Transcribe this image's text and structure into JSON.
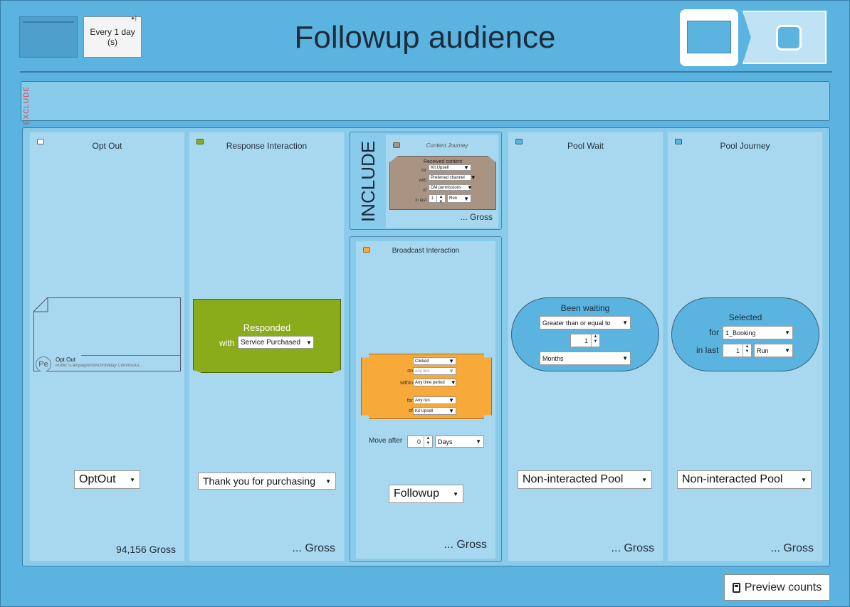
{
  "header": {
    "schedule_text": "Every 1 day (s)",
    "title": "Followup audience"
  },
  "exclude": {
    "label": "EXCLUDE"
  },
  "include": {
    "label": "INCLUDE"
  },
  "columns": {
    "opt_out": {
      "title": "Opt Out",
      "card_name": "Opt Out",
      "card_path": "Public:\\Campaigns\\BAU\\Holiday Comms\\Au...",
      "avatar": "Pe",
      "dropdown": "OptOut",
      "gross": "94,156 Gross"
    },
    "response": {
      "title": "Response Interaction",
      "card_label": "Responded",
      "with_label": "with",
      "with_value": "Service Purchased",
      "dropdown": "Thank you for purchasing",
      "gross": "... Gross"
    },
    "content_journey": {
      "title": "Content Journey",
      "head": "Received content",
      "for_label": "for",
      "for_value": "Kit Upsell",
      "with_label": "with",
      "with_value": "Preferred channel",
      "of_label": "of",
      "of_value": "DM permissions",
      "inlast_label": "in last",
      "inlast_num": "1",
      "inlast_unit": "Run",
      "gross": "... Gross"
    },
    "broadcast": {
      "title": "Broadcast Interaction",
      "action_value": "Clicked",
      "on_label": "on",
      "on_value": "any link",
      "within_label": "within",
      "within_value": "Any time period",
      "for_label": "for",
      "for_value": "Any run",
      "of_label": "of",
      "of_value": "Kit Upsell",
      "move_after_label": "Move after",
      "move_after_num": "0",
      "move_after_unit": "Days",
      "dropdown": "Followup",
      "gross": "... Gross"
    },
    "pool_wait": {
      "title": "Pool Wait",
      "pill_title": "Been waiting",
      "operator": "Greater than or equal to",
      "num": "1",
      "unit": "Months",
      "dropdown": "Non-interacted Pool",
      "gross": "... Gross"
    },
    "pool_journey": {
      "title": "Pool Journey",
      "pill_title": "Selected",
      "for_label": "for",
      "for_value": "1_Booking",
      "inlast_label": "in last",
      "inlast_num": "1",
      "inlast_unit": "Run",
      "dropdown": "Non-interacted Pool",
      "gross": "... Gross"
    }
  },
  "preview_button": "Preview counts",
  "colors": {
    "background": "#5bb3e0",
    "panel": "#88cbeb",
    "column": "#a8d8ef",
    "response_card": "#8aab1a",
    "content_card": "#a99383",
    "broadcast_card": "#f7a93a",
    "exclude_text": "#e0404a"
  },
  "icons": [
    "calculator-icon",
    "caret-down-icon",
    "spinner-up-icon",
    "spinner-down-icon"
  ]
}
